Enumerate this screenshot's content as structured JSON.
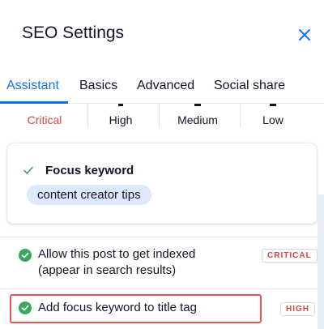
{
  "header": {
    "title": "SEO Settings",
    "close_icon": "close-icon"
  },
  "tabs": [
    {
      "label": "Assistant",
      "active": true
    },
    {
      "label": "Basics",
      "active": false
    },
    {
      "label": "Advanced",
      "active": false
    },
    {
      "label": "Social share",
      "active": false
    }
  ],
  "scores": [
    {
      "label": "Critical"
    },
    {
      "label": "High"
    },
    {
      "label": "Medium"
    },
    {
      "label": "Low"
    }
  ],
  "focus_keyword": {
    "title": "Focus keyword",
    "value": "content creator tips"
  },
  "checklist": [
    {
      "text": "Allow this post to get indexed (appear in search results)",
      "badge": "CRITICAL",
      "status": "done"
    },
    {
      "text": "Add focus keyword to title tag",
      "badge": "HIGH",
      "status": "done"
    }
  ],
  "colors": {
    "accent": "#116dff",
    "success": "#3aa55d",
    "critical": "#d6453d",
    "highlight": "#e8574f"
  }
}
